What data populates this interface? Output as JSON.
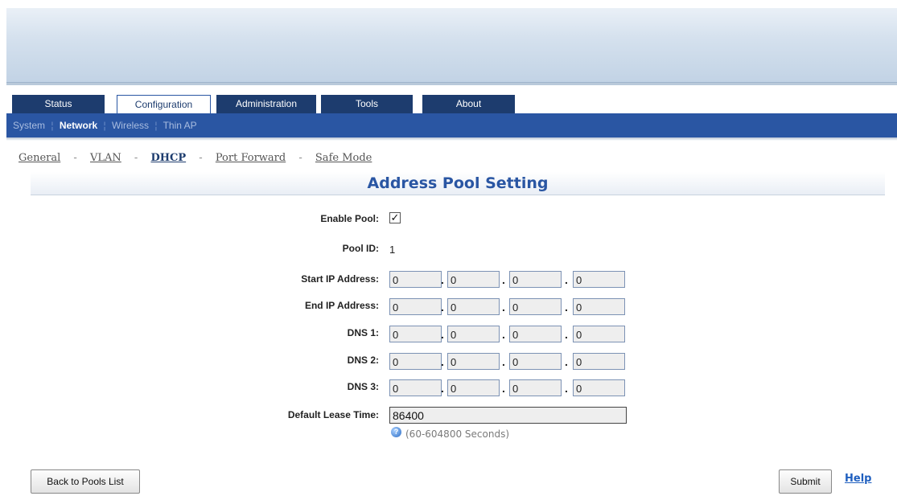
{
  "tabs": [
    {
      "label": "Status"
    },
    {
      "label": "Configuration",
      "active": true
    },
    {
      "label": "Administration"
    },
    {
      "label": "Tools"
    },
    {
      "label": "About"
    }
  ],
  "subnav": [
    {
      "label": "System"
    },
    {
      "label": "Network",
      "active": true
    },
    {
      "label": "Wireless"
    },
    {
      "label": "Thin AP"
    }
  ],
  "crumbs": [
    {
      "label": "General"
    },
    {
      "label": "VLAN"
    },
    {
      "label": "DHCP",
      "current": true
    },
    {
      "label": "Port Forward"
    },
    {
      "label": "Safe Mode"
    }
  ],
  "crumb_separator": "-",
  "section_title": "Address Pool Setting",
  "form": {
    "enable_pool_label": "Enable Pool:",
    "enable_pool_checked": true,
    "pool_id_label": "Pool ID:",
    "pool_id_value": "1",
    "start_ip_label": "Start IP Address:",
    "start_ip": [
      "0",
      "0",
      "0",
      "0"
    ],
    "end_ip_label": "End IP Address:",
    "end_ip": [
      "0",
      "0",
      "0",
      "0"
    ],
    "dns1_label": "DNS 1:",
    "dns1": [
      "0",
      "0",
      "0",
      "0"
    ],
    "dns2_label": "DNS 2:",
    "dns2": [
      "0",
      "0",
      "0",
      "0"
    ],
    "dns3_label": "DNS 3:",
    "dns3": [
      "0",
      "0",
      "0",
      "0"
    ],
    "ip_separator": ".",
    "lease_label": "Default Lease Time:",
    "lease_value": "86400",
    "lease_hint": "(60-604800 Seconds)"
  },
  "buttons": {
    "back_label": "Back to Pools List",
    "submit_label": "Submit",
    "help_label": "Help"
  },
  "colors": {
    "nav_dark": "#1d3c6e",
    "subnav_blue": "#2a56a3",
    "title_blue": "#2a56a3"
  }
}
